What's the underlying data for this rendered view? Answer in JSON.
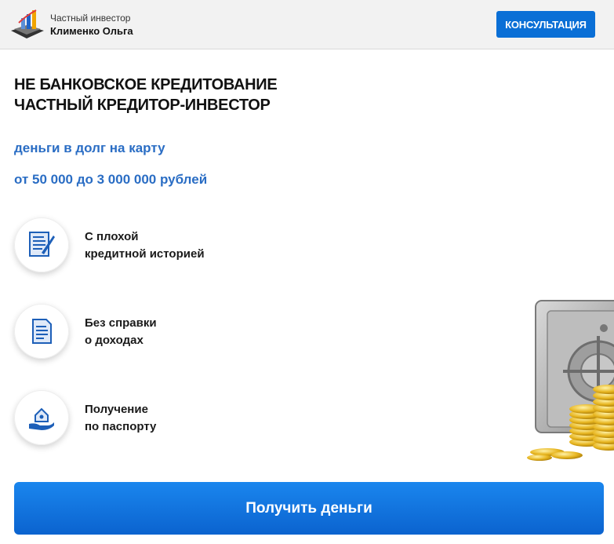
{
  "header": {
    "brand_line1": "Частный инвестор",
    "brand_line2": "Клименко Ольга",
    "consult_label": "КОНСУЛЬТАЦИЯ"
  },
  "hero": {
    "title_line1": "НЕ БАНКОВСКОЕ КРЕДИТОВАНИЕ",
    "title_line2": "ЧАСТНЫЙ КРЕДИТОР-ИНВЕСТОР",
    "subtitle1": "деньги в долг на карту",
    "subtitle2": "от 50 000 до 3 000 000 рублей"
  },
  "features": [
    {
      "icon": "document-pen-icon",
      "line1": "С плохой",
      "line2": "кредитной историей"
    },
    {
      "icon": "document-icon",
      "line1": "Без справки",
      "line2": "о доходах"
    },
    {
      "icon": "hand-house-icon",
      "line1": "Получение",
      "line2": "по паспорту"
    }
  ],
  "cta": {
    "label": "Получить деньги"
  },
  "colors": {
    "accent": "#0a6fd6",
    "subtitle": "#2a6dc4",
    "header_bg": "#f2f2f2"
  }
}
